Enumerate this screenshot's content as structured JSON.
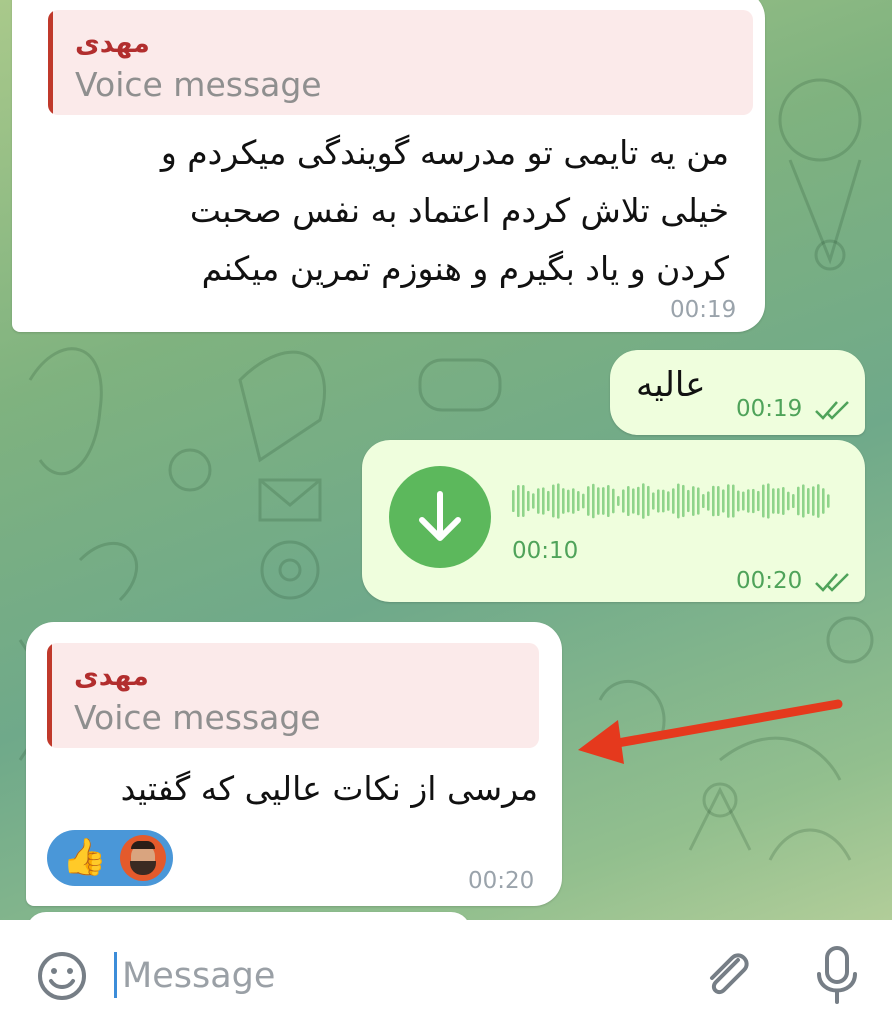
{
  "messages": [
    {
      "reply_name": "مهدی",
      "reply_text": "Voice message",
      "lines": [
        "من یه تایمی تو مدرسه گویندگی میکردم و",
        "خیلی تلاش کردم اعتماد به نفس صحبت",
        "کردن و یاد بگیرم و هنوزم تمرین میکنم"
      ],
      "time": "00:19"
    },
    {
      "text": "عالیه",
      "time": "00:19"
    },
    {
      "voice_duration": "00:10",
      "time": "00:20"
    },
    {
      "reply_name": "مهدی",
      "reply_text": "Voice message",
      "text": "مرسی از نکات عالیی که گفتید",
      "reactions": [
        "thumbs-up-icon",
        "avatar"
      ],
      "time": "00:20"
    }
  ],
  "composer": {
    "placeholder": "Message"
  },
  "colors": {
    "incoming": "#ffffff",
    "outgoing": "#effedd",
    "accent_green": "#5cb85c",
    "reply_name": "#b22e2e",
    "arrow": "#e5391d"
  }
}
